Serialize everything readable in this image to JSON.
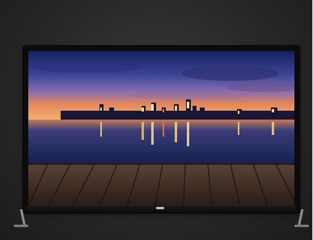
{
  "image": {
    "subject": "tv-product-photo",
    "screen_scene": "city-skyline-at-dusk-over-lake-with-wooden-dock",
    "colors": {
      "background": "#2a2a2a",
      "bezel": "#0c0c0c",
      "sky_top": "#1e2a6b",
      "sky_mid": "#4a4fa0",
      "sky_horizon": "#e07a4a",
      "water": "#1b2a55",
      "dock": "#3a2a22"
    }
  }
}
